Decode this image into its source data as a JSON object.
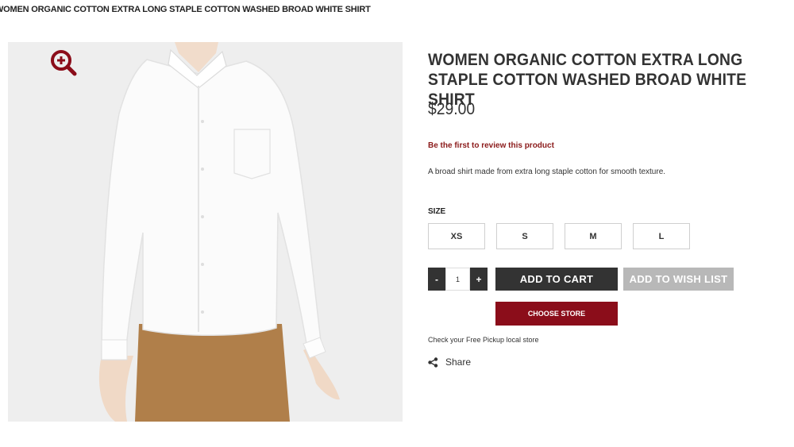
{
  "breadcrumb": {
    "text": "WOMEN ORGANIC COTTON EXTRA LONG STAPLE COTTON WASHED BROAD WHITE SHIRT"
  },
  "product": {
    "title": "WOMEN ORGANIC COTTON EXTRA LONG STAPLE COTTON WASHED BROAD WHITE SHIRT",
    "price": "$29.00",
    "review_link": "Be the first to review this product",
    "description": "A broad shirt made from extra long staple cotton for smooth texture.",
    "image_icon": "zoom-in-icon"
  },
  "size": {
    "label": "SIZE",
    "options": [
      "XS",
      "S",
      "M",
      "L"
    ]
  },
  "quantity": {
    "decrement": "-",
    "value": "1",
    "increment": "+"
  },
  "actions": {
    "add_to_cart": "ADD TO CART",
    "add_to_wish_list": "ADD TO WISH LIST",
    "choose_store": "CHOOSE STORE",
    "pickup_text": "Check your Free Pickup local store",
    "share": "Share",
    "share_icon": "share-icon"
  },
  "colors": {
    "accent": "#8b0d1a",
    "primary_button": "#333333",
    "disabled_button": "#b8b8b8"
  }
}
